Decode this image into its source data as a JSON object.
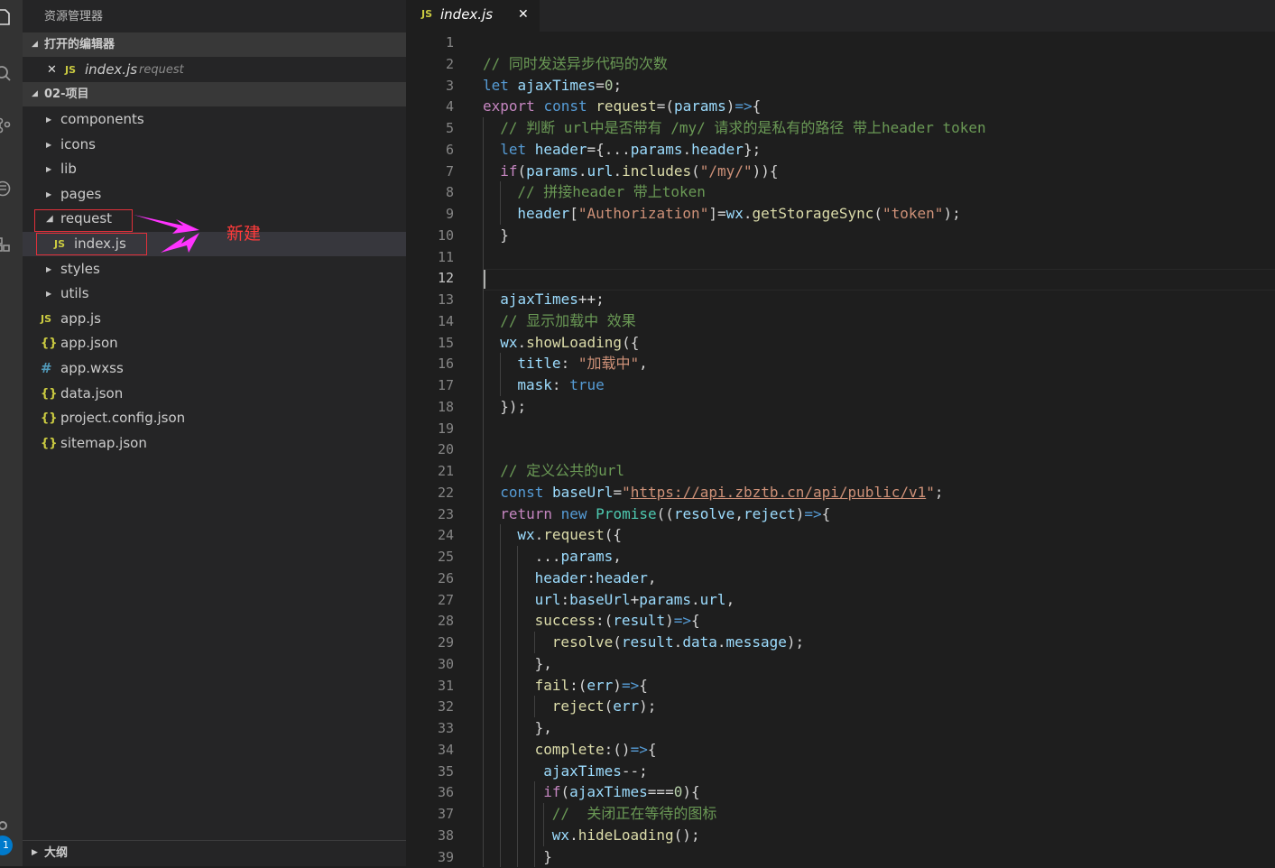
{
  "sidebar": {
    "title": "资源管理器",
    "open_editors": {
      "header": "打开的编辑器",
      "file_name": "index.js",
      "file_dir": "request"
    },
    "project": {
      "header": "02-项目",
      "items": [
        {
          "label": "components",
          "kind": "folder"
        },
        {
          "label": "icons",
          "kind": "folder"
        },
        {
          "label": "lib",
          "kind": "folder"
        },
        {
          "label": "pages",
          "kind": "folder"
        },
        {
          "label": "request",
          "kind": "folder-open"
        },
        {
          "label": "index.js",
          "kind": "js"
        },
        {
          "label": "styles",
          "kind": "folder"
        },
        {
          "label": "utils",
          "kind": "folder"
        },
        {
          "label": "app.js",
          "kind": "js"
        },
        {
          "label": "app.json",
          "kind": "json"
        },
        {
          "label": "app.wxss",
          "kind": "wxss"
        },
        {
          "label": "data.json",
          "kind": "json"
        },
        {
          "label": "project.config.json",
          "kind": "json"
        },
        {
          "label": "sitemap.json",
          "kind": "json"
        }
      ]
    },
    "annotation": "新建",
    "outline_header": "大纲"
  },
  "icons": {
    "js": "JS",
    "json": "{}",
    "wxss": "#",
    "close": "✕",
    "chevron_right": "▶",
    "chevron_down": "◢"
  },
  "activity_bar": {
    "badge": "1"
  },
  "editor": {
    "tab": {
      "label": "index.js",
      "icon": "JS",
      "close": "✕"
    },
    "active_line": 12,
    "lines": [
      {
        "n": "1",
        "indent": 0,
        "tokens": []
      },
      {
        "n": "2",
        "indent": 0,
        "tokens": [
          [
            "com",
            "// 同时发送异步代码的次数"
          ]
        ]
      },
      {
        "n": "3",
        "indent": 0,
        "tokens": [
          [
            "kw",
            "let"
          ],
          [
            "op",
            " "
          ],
          [
            "var",
            "ajaxTimes"
          ],
          [
            "op",
            "="
          ],
          [
            "num",
            "0"
          ],
          [
            "op",
            ";"
          ]
        ]
      },
      {
        "n": "4",
        "indent": 0,
        "tokens": [
          [
            "ctl",
            "export"
          ],
          [
            "op",
            " "
          ],
          [
            "kw",
            "const"
          ],
          [
            "op",
            " "
          ],
          [
            "fn",
            "request"
          ],
          [
            "op",
            "=("
          ],
          [
            "var",
            "params"
          ],
          [
            "op",
            ")"
          ],
          [
            "kw",
            "=>"
          ],
          [
            "op",
            "{"
          ]
        ]
      },
      {
        "n": "5",
        "indent": 1,
        "tokens": [
          [
            "com",
            "// 判断 url中是否带有 /my/ 请求的是私有的路径 带上header token"
          ]
        ]
      },
      {
        "n": "6",
        "indent": 1,
        "tokens": [
          [
            "kw",
            "let"
          ],
          [
            "op",
            " "
          ],
          [
            "var",
            "header"
          ],
          [
            "op",
            "={..."
          ],
          [
            "var",
            "params"
          ],
          [
            "op",
            "."
          ],
          [
            "var",
            "header"
          ],
          [
            "op",
            "};"
          ]
        ]
      },
      {
        "n": "7",
        "indent": 1,
        "tokens": [
          [
            "ctl",
            "if"
          ],
          [
            "op",
            "("
          ],
          [
            "var",
            "params"
          ],
          [
            "op",
            "."
          ],
          [
            "var",
            "url"
          ],
          [
            "op",
            "."
          ],
          [
            "fn",
            "includes"
          ],
          [
            "op",
            "("
          ],
          [
            "str",
            "\"/my/\""
          ],
          [
            "op",
            ")){"
          ]
        ]
      },
      {
        "n": "8",
        "indent": 2,
        "tokens": [
          [
            "com",
            "// 拼接header 带上token"
          ]
        ]
      },
      {
        "n": "9",
        "indent": 2,
        "tokens": [
          [
            "var",
            "header"
          ],
          [
            "op",
            "["
          ],
          [
            "str",
            "\"Authorization\""
          ],
          [
            "op",
            "]="
          ],
          [
            "var",
            "wx"
          ],
          [
            "op",
            "."
          ],
          [
            "fn",
            "getStorageSync"
          ],
          [
            "op",
            "("
          ],
          [
            "str",
            "\"token\""
          ],
          [
            "op",
            ");"
          ]
        ]
      },
      {
        "n": "10",
        "indent": 1,
        "tokens": [
          [
            "op",
            "}"
          ]
        ]
      },
      {
        "n": "11",
        "indent": 0,
        "tokens": []
      },
      {
        "n": "12",
        "indent": 0,
        "tokens": []
      },
      {
        "n": "13",
        "indent": 1,
        "tokens": [
          [
            "var",
            "ajaxTimes"
          ],
          [
            "op",
            "++;"
          ]
        ]
      },
      {
        "n": "14",
        "indent": 1,
        "tokens": [
          [
            "com",
            "// 显示加载中 效果"
          ]
        ]
      },
      {
        "n": "15",
        "indent": 1,
        "tokens": [
          [
            "var",
            "wx"
          ],
          [
            "op",
            "."
          ],
          [
            "fn",
            "showLoading"
          ],
          [
            "op",
            "({"
          ]
        ]
      },
      {
        "n": "16",
        "indent": 2,
        "tokens": [
          [
            "var",
            "title"
          ],
          [
            "op",
            ": "
          ],
          [
            "str",
            "\"加载中\""
          ],
          [
            "op",
            ","
          ]
        ]
      },
      {
        "n": "17",
        "indent": 2,
        "tokens": [
          [
            "var",
            "mask"
          ],
          [
            "op",
            ": "
          ],
          [
            "kw",
            "true"
          ]
        ]
      },
      {
        "n": "18",
        "indent": 1,
        "tokens": [
          [
            "op",
            "});"
          ]
        ]
      },
      {
        "n": "19",
        "indent": 0,
        "tokens": []
      },
      {
        "n": "20",
        "indent": 0,
        "tokens": []
      },
      {
        "n": "21",
        "indent": 1,
        "tokens": [
          [
            "com",
            "// 定义公共的url"
          ]
        ]
      },
      {
        "n": "22",
        "indent": 1,
        "tokens": [
          [
            "kw",
            "const"
          ],
          [
            "op",
            " "
          ],
          [
            "var",
            "baseUrl"
          ],
          [
            "op",
            "="
          ],
          [
            "str",
            "\""
          ],
          [
            "url",
            "https://api.zbztb.cn/api/public/v1"
          ],
          [
            "str",
            "\""
          ],
          [
            "op",
            ";"
          ]
        ]
      },
      {
        "n": "23",
        "indent": 1,
        "tokens": [
          [
            "ctl",
            "return"
          ],
          [
            "op",
            " "
          ],
          [
            "kw",
            "new"
          ],
          [
            "op",
            " "
          ],
          [
            "cls",
            "Promise"
          ],
          [
            "op",
            "(("
          ],
          [
            "var",
            "resolve"
          ],
          [
            "op",
            ","
          ],
          [
            "var",
            "reject"
          ],
          [
            "op",
            ")"
          ],
          [
            "kw",
            "=>"
          ],
          [
            "op",
            "{"
          ]
        ]
      },
      {
        "n": "24",
        "indent": 2,
        "tokens": [
          [
            "var",
            "wx"
          ],
          [
            "op",
            "."
          ],
          [
            "fn",
            "request"
          ],
          [
            "op",
            "({"
          ]
        ]
      },
      {
        "n": "25",
        "indent": 3,
        "tokens": [
          [
            "op",
            "..."
          ],
          [
            "var",
            "params"
          ],
          [
            "op",
            ","
          ]
        ]
      },
      {
        "n": "26",
        "indent": 3,
        "tokens": [
          [
            "var",
            "header"
          ],
          [
            "op",
            ":"
          ],
          [
            "var",
            "header"
          ],
          [
            "op",
            ","
          ]
        ]
      },
      {
        "n": "27",
        "indent": 3,
        "tokens": [
          [
            "var",
            "url"
          ],
          [
            "op",
            ":"
          ],
          [
            "var",
            "baseUrl"
          ],
          [
            "op",
            "+"
          ],
          [
            "var",
            "params"
          ],
          [
            "op",
            "."
          ],
          [
            "var",
            "url"
          ],
          [
            "op",
            ","
          ]
        ]
      },
      {
        "n": "28",
        "indent": 3,
        "tokens": [
          [
            "fn",
            "success"
          ],
          [
            "op",
            ":("
          ],
          [
            "var",
            "result"
          ],
          [
            "op",
            ")"
          ],
          [
            "kw",
            "=>"
          ],
          [
            "op",
            "{"
          ]
        ]
      },
      {
        "n": "29",
        "indent": 4,
        "tokens": [
          [
            "fn",
            "resolve"
          ],
          [
            "op",
            "("
          ],
          [
            "var",
            "result"
          ],
          [
            "op",
            "."
          ],
          [
            "var",
            "data"
          ],
          [
            "op",
            "."
          ],
          [
            "var",
            "message"
          ],
          [
            "op",
            ");"
          ]
        ]
      },
      {
        "n": "30",
        "indent": 3,
        "tokens": [
          [
            "op",
            "},"
          ]
        ]
      },
      {
        "n": "31",
        "indent": 3,
        "tokens": [
          [
            "fn",
            "fail"
          ],
          [
            "op",
            ":("
          ],
          [
            "var",
            "err"
          ],
          [
            "op",
            ")"
          ],
          [
            "kw",
            "=>"
          ],
          [
            "op",
            "{"
          ]
        ]
      },
      {
        "n": "32",
        "indent": 4,
        "tokens": [
          [
            "fn",
            "reject"
          ],
          [
            "op",
            "("
          ],
          [
            "var",
            "err"
          ],
          [
            "op",
            ");"
          ]
        ]
      },
      {
        "n": "33",
        "indent": 3,
        "tokens": [
          [
            "op",
            "},"
          ]
        ]
      },
      {
        "n": "34",
        "indent": 3,
        "tokens": [
          [
            "fn",
            "complete"
          ],
          [
            "op",
            ":()"
          ],
          [
            "kw",
            "=>"
          ],
          [
            "op",
            "{"
          ]
        ]
      },
      {
        "n": "35",
        "indent": 3.5,
        "tokens": [
          [
            "var",
            "ajaxTimes"
          ],
          [
            "op",
            "--;"
          ]
        ]
      },
      {
        "n": "36",
        "indent": 3.5,
        "tokens": [
          [
            "ctl",
            "if"
          ],
          [
            "op",
            "("
          ],
          [
            "var",
            "ajaxTimes"
          ],
          [
            "op",
            "==="
          ],
          [
            "num",
            "0"
          ],
          [
            "op",
            "){"
          ]
        ]
      },
      {
        "n": "37",
        "indent": 4,
        "tokens": [
          [
            "com",
            "//  关闭正在等待的图标"
          ]
        ]
      },
      {
        "n": "38",
        "indent": 4,
        "tokens": [
          [
            "var",
            "wx"
          ],
          [
            "op",
            "."
          ],
          [
            "fn",
            "hideLoading"
          ],
          [
            "op",
            "();"
          ]
        ]
      },
      {
        "n": "39",
        "indent": 3.5,
        "tokens": [
          [
            "op",
            "}"
          ]
        ]
      }
    ]
  }
}
